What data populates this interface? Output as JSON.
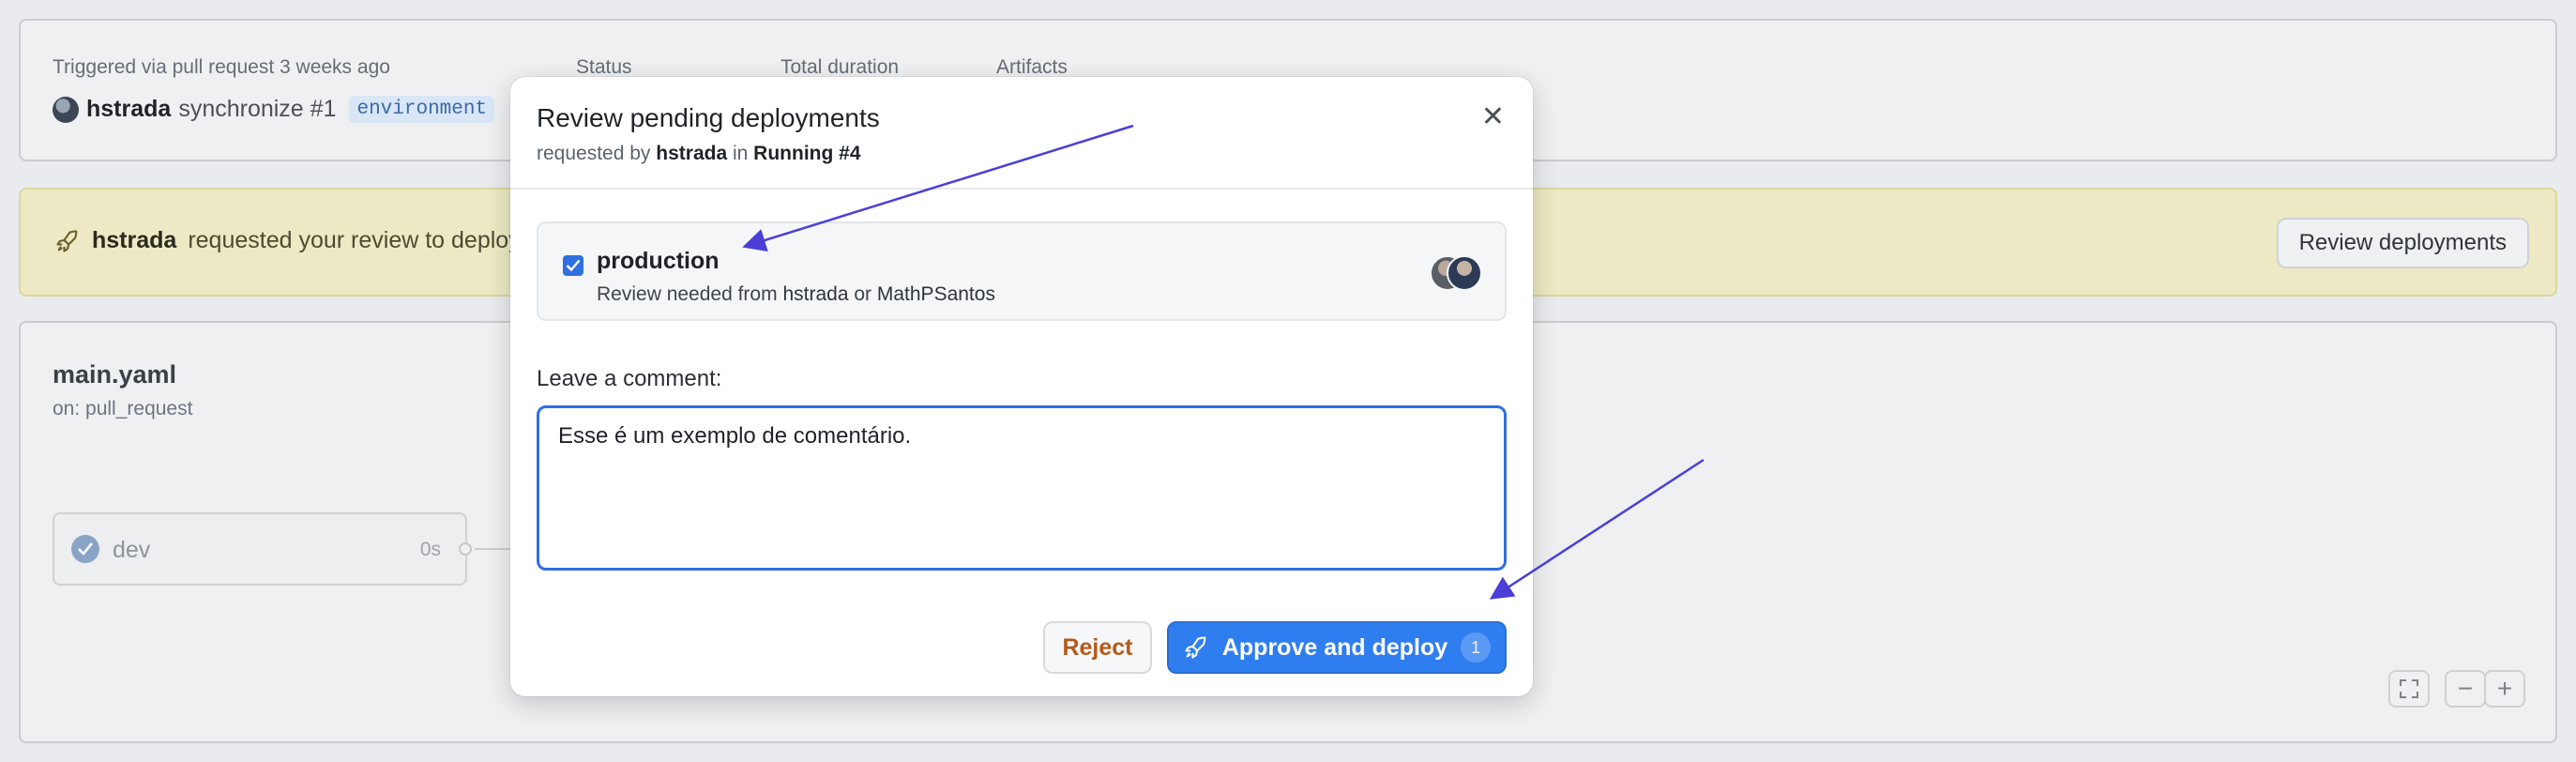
{
  "summary": {
    "triggered_label": "Triggered via pull request 3 weeks ago",
    "status_label": "Status",
    "duration_label": "Total duration",
    "artifacts_label": "Artifacts",
    "actor": "hstrada",
    "event": "synchronize #1",
    "env_tag": "environment"
  },
  "banner": {
    "actor": "hstrada",
    "text": "requested your review to deploy",
    "review_button": "Review deployments"
  },
  "workflow": {
    "file": "main.yaml",
    "trigger": "on: pull_request",
    "job": {
      "name": "dev",
      "duration": "0s"
    }
  },
  "zoom": {
    "fullscreen_icon": "fullscreen-icon",
    "minus": "−",
    "plus": "+"
  },
  "modal": {
    "title": "Review pending deployments",
    "sub_prefix": "requested by",
    "sub_actor": "hstrada",
    "sub_in": "in",
    "sub_run": "Running #4",
    "close": "✕",
    "environment": {
      "name": "production",
      "checked": true,
      "need_prefix": "Review needed from",
      "reviewer1": "hstrada",
      "or": "or",
      "reviewer2": "MathPSantos"
    },
    "comment_label": "Leave a comment:",
    "comment_value": "Esse é um exemplo de comentário.",
    "reject": "Reject",
    "approve": "Approve and deploy",
    "approve_count": "1"
  },
  "colors": {
    "accent": "#2f7ef0",
    "reject": "#b55a1b",
    "arrow": "#4b3fd8"
  }
}
